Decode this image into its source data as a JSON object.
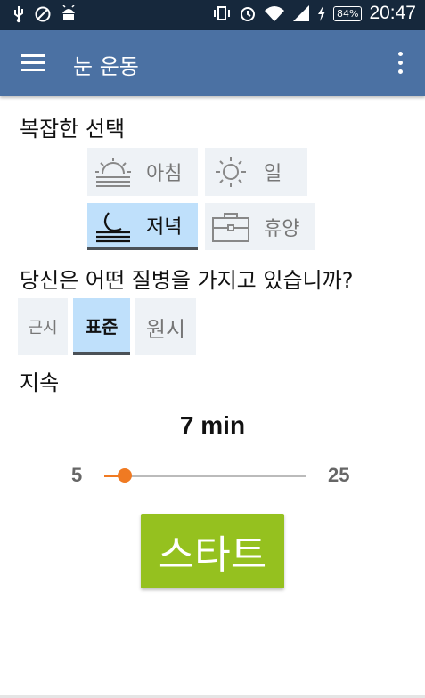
{
  "status_bar": {
    "time": "20:47",
    "battery": "84%",
    "icons_left": [
      "usb-icon",
      "blocked-icon",
      "android-icon"
    ],
    "icons_right": [
      "vibrate-icon",
      "alarm-icon",
      "wifi-icon",
      "signal-icon",
      "charging-icon"
    ]
  },
  "app_bar": {
    "title": "눈 운동",
    "menu_icon": "hamburger-icon",
    "overflow_icon": "more-vertical-icon",
    "color": "#4b71a3"
  },
  "complex_choice": {
    "title": "복잡한 선택",
    "options": [
      {
        "label": "아침",
        "icon": "sunrise-icon",
        "selected": false
      },
      {
        "label": "일",
        "icon": "sun-icon",
        "selected": false
      },
      {
        "label": "저녁",
        "icon": "moon-waves-icon",
        "selected": true
      },
      {
        "label": "휴양",
        "icon": "suitcase-icon",
        "selected": false
      }
    ]
  },
  "condition": {
    "title": "당신은 어떤 질병을 가지고 있습니까?",
    "options": [
      {
        "label": "근시",
        "selected": false
      },
      {
        "label": "표준",
        "selected": true
      },
      {
        "label": "원시",
        "selected": false
      }
    ]
  },
  "duration": {
    "title": "지속",
    "value_label": "7 min",
    "min_label": "5",
    "max_label": "25",
    "min": 5,
    "max": 25,
    "value": 7,
    "accent_color": "#f07a22"
  },
  "start_button": {
    "label": "스타트",
    "color": "#95c11f"
  },
  "colors": {
    "tile_background": "#eef2f6",
    "tile_selected": "#bfe0fb"
  }
}
